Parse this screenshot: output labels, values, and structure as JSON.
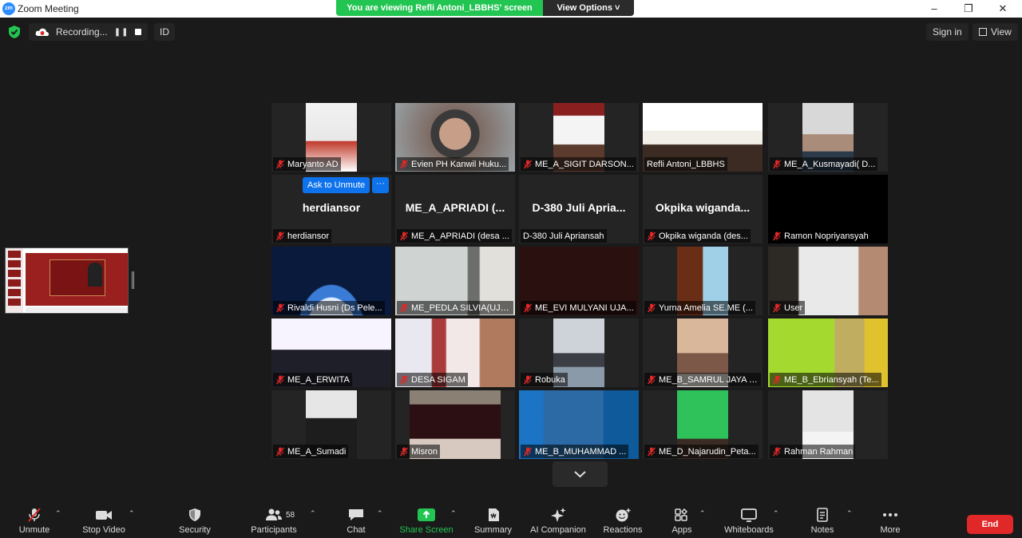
{
  "window": {
    "title": "Zoom Meeting",
    "logo_text": "zm",
    "controls": [
      "minimize",
      "restore",
      "close"
    ]
  },
  "banner": {
    "message": "You are viewing Refli Antoni_LBBHS' screen",
    "options_label": "View Options"
  },
  "topbar": {
    "recording_label": "Recording...",
    "id_label": "ID",
    "sign_in_label": "Sign in",
    "view_label": "View"
  },
  "overlay": {
    "ask_to_unmute": "Ask to Unmute",
    "more": "···"
  },
  "participants": [
    {
      "name": "Maryanto AD",
      "muted": true,
      "video": true
    },
    {
      "name": "Evien PH Kanwil Huku...",
      "muted": true,
      "video": true
    },
    {
      "name": "ME_A_SIGIT DARSON...",
      "muted": true,
      "video": true
    },
    {
      "name": "Refli Antoni_LBBHS",
      "muted": false,
      "video": true,
      "active_speaker": true
    },
    {
      "name": "ME_A_Kusmayadi( D...",
      "muted": true,
      "video": true
    },
    {
      "name": "herdiansor",
      "big_name": "herdiansor",
      "muted": true,
      "video": false
    },
    {
      "name": "ME_A_APRIADI (desa ...",
      "big_name": "ME_A_APRIADI (...",
      "muted": true,
      "video": false
    },
    {
      "name": "D-380 Juli Apriansah",
      "big_name": "D-380 Juli Apria...",
      "muted": false,
      "video": false
    },
    {
      "name": "Okpika wiganda (des...",
      "big_name": "Okpika  wiganda...",
      "muted": true,
      "video": false
    },
    {
      "name": "Ramon Nopriyansyah",
      "muted": true,
      "video": true
    },
    {
      "name": "Rivaldi Husni (Ds Pele...",
      "muted": true,
      "video": true
    },
    {
      "name": "ME_PEDLA SILVIA(UJA...",
      "muted": true,
      "video": true
    },
    {
      "name": "ME_EVI MULYANI UJA...",
      "muted": true,
      "video": true
    },
    {
      "name": "Yurna Amelia SE.ME (...",
      "muted": true,
      "video": true
    },
    {
      "name": "User",
      "muted": true,
      "video": true
    },
    {
      "name": "ME_A_ERWITA",
      "muted": true,
      "video": true
    },
    {
      "name": "DESA SIGAM",
      "muted": true,
      "video": true
    },
    {
      "name": "Robuka",
      "muted": true,
      "video": true
    },
    {
      "name": "ME_B_SAMRUL JAYA (...",
      "muted": true,
      "video": true
    },
    {
      "name": "ME_B_Ebriansyah (Te...",
      "muted": true,
      "video": true
    },
    {
      "name": "ME_A_Sumadi",
      "muted": true,
      "video": true
    },
    {
      "name": "Misron",
      "muted": true,
      "video": true
    },
    {
      "name": "ME_B_MUHAMMAD ...",
      "muted": true,
      "video": true
    },
    {
      "name": "ME_D_Najarudin_Peta...",
      "muted": true,
      "video": true
    },
    {
      "name": "Rahman Rahman",
      "muted": true,
      "video": true
    }
  ],
  "toolbar": {
    "unmute": "Unmute",
    "stop_video": "Stop Video",
    "security": "Security",
    "participants": "Participants",
    "participants_count": "58",
    "chat": "Chat",
    "share_screen": "Share Screen",
    "summary": "Summary",
    "ai_companion": "AI Companion",
    "reactions": "Reactions",
    "apps": "Apps",
    "whiteboards": "Whiteboards",
    "notes": "Notes",
    "more": "More",
    "end": "End"
  },
  "colors": {
    "background": "#1a1a1a",
    "tile": "#242424",
    "banner_green": "#23c552",
    "active_speaker": "#c8e060",
    "unmute_blue": "#0e72ed",
    "end_red": "#e02828",
    "muted_red": "#e02828"
  },
  "icons": {
    "mic_off": "mic-off-icon",
    "shield": "shield-icon",
    "cloud": "cloud-record-icon",
    "chevron_down": "chevron-down-icon"
  }
}
